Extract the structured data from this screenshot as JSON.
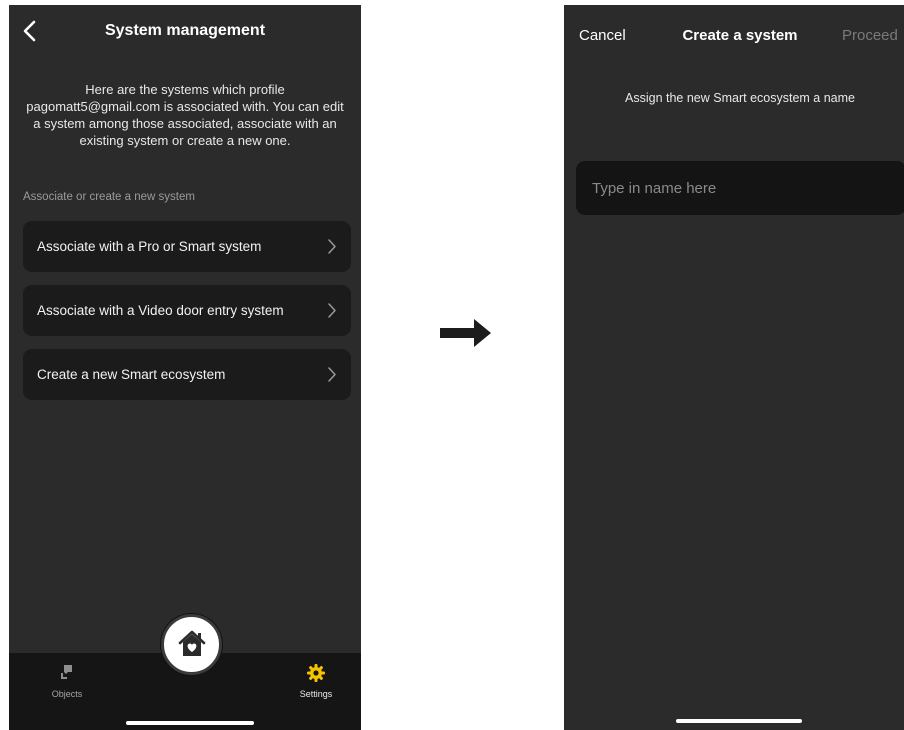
{
  "left_screen": {
    "title": "System management",
    "intro": "Here are the systems which profile pagomatt5@gmail.com is associated with. You can edit a system among those associated, associate with an existing system or create a new one.",
    "section_label": "Associate or create a new system",
    "options": [
      {
        "label": "Associate with a Pro or Smart system",
        "icon": "chevron-right-icon"
      },
      {
        "label": "Associate with a Video door entry system",
        "icon": "chevron-right-icon"
      },
      {
        "label": "Create a new Smart ecosystem",
        "icon": "chevron-right-icon"
      }
    ],
    "tabbar": {
      "objects_label": "Objects",
      "settings_label": "Settings",
      "accent_color": "#f5c400"
    }
  },
  "right_screen": {
    "cancel_label": "Cancel",
    "title": "Create a system",
    "proceed_label": "Proceed",
    "instruction": "Assign the new Smart ecosystem a name",
    "name_input": {
      "value": "",
      "placeholder": "Type in name here"
    }
  }
}
